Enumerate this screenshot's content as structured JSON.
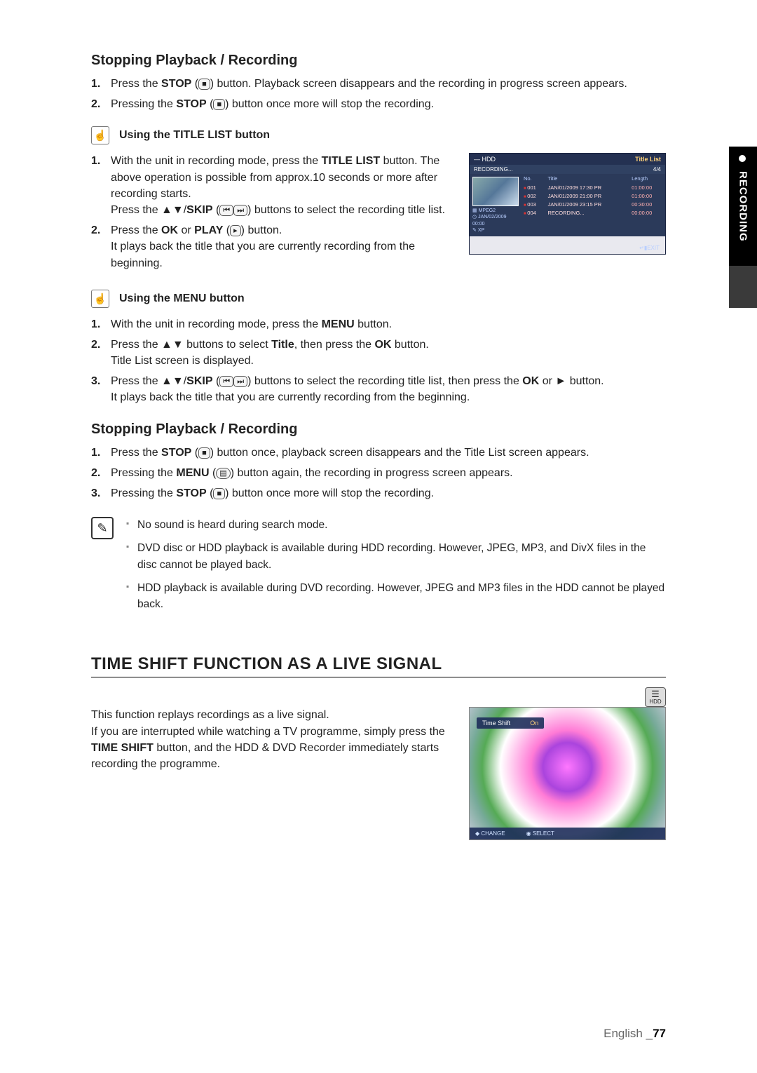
{
  "side_tab_label": "RECORDING",
  "section1": {
    "title": "Stopping Playback / Recording",
    "steps": [
      {
        "pre": "Press the ",
        "bold": "STOP",
        "icon": "■",
        "post": " button. Playback screen disappears and the recording in progress screen appears."
      },
      {
        "pre": "Pressing the ",
        "bold": "STOP",
        "icon": "■",
        "post": " button once more will stop the recording."
      }
    ]
  },
  "hint1": {
    "title": "Using the TITLE LIST button",
    "steps": [
      {
        "parts": [
          {
            "t": "With the unit in recording mode, press the "
          },
          {
            "b": "TITLE LIST"
          },
          {
            "t": " button. The above operation is possible from approx.10 seconds or more after recording starts."
          },
          {
            "br": true
          },
          {
            "t": "Press the ▲▼/"
          },
          {
            "b": "SKIP"
          },
          {
            "t": " ("
          },
          {
            "icon": "⏮"
          },
          {
            "icon": "⏭"
          },
          {
            "t": ") buttons to select the recording title list."
          }
        ]
      },
      {
        "parts": [
          {
            "t": "Press the "
          },
          {
            "b": "OK"
          },
          {
            "t": " or "
          },
          {
            "b": "PLAY"
          },
          {
            "t": " ("
          },
          {
            "icon": "▸"
          },
          {
            "t": ") button."
          },
          {
            "br": true
          },
          {
            "t": "It plays back the title that you are currently recording from the beginning."
          }
        ]
      }
    ]
  },
  "titlelist_ui": {
    "device": "HDD",
    "header_right": "Title List",
    "rec_label": "RECORDING...",
    "page": "4/4",
    "meta_codec": "MPEG2",
    "meta_date": "JAN/02/2009 00:00",
    "meta_mode": "XP",
    "cols": {
      "no": "No.",
      "title": "Title",
      "length": "Length"
    },
    "rows": [
      {
        "no": "001",
        "title": "JAN/01/2009 17:30 PR",
        "length": "01:00:00"
      },
      {
        "no": "002",
        "title": "JAN/01/2009 21:00 PR",
        "length": "01:00:00"
      },
      {
        "no": "003",
        "title": "JAN/01/2009 23:15 PR",
        "length": "00:30:00"
      },
      {
        "no": "004",
        "title": "RECORDING...",
        "length": "00:00:00"
      }
    ],
    "footer": "EXIT"
  },
  "hint2": {
    "title": "Using the MENU button",
    "steps": [
      {
        "parts": [
          {
            "t": "With the unit in recording mode, press the "
          },
          {
            "b": "MENU"
          },
          {
            "t": " button."
          }
        ]
      },
      {
        "parts": [
          {
            "t": "Press the ▲▼ buttons to select "
          },
          {
            "b": "Title"
          },
          {
            "t": ", then press the "
          },
          {
            "b": "OK"
          },
          {
            "t": " button."
          },
          {
            "br": true
          },
          {
            "t": "Title List screen is displayed."
          }
        ]
      },
      {
        "parts": [
          {
            "t": "Press the ▲▼/"
          },
          {
            "b": "SKIP"
          },
          {
            "t": " ("
          },
          {
            "icon": "⏮"
          },
          {
            "icon": "⏭"
          },
          {
            "t": ") buttons to select the recording title list, then press the "
          },
          {
            "b": "OK"
          },
          {
            "t": " or ► button."
          },
          {
            "br": true
          },
          {
            "t": "It plays back the title that you are currently recording from the beginning."
          }
        ]
      }
    ]
  },
  "section2": {
    "title": "Stopping Playback / Recording",
    "steps": [
      {
        "pre": "Press the ",
        "bold": "STOP",
        "icon": "■",
        "post": " button once, playback screen disappears and the Title List screen appears."
      },
      {
        "pre": "Pressing the ",
        "bold": "MENU",
        "icon": "▤",
        "post": " button again, the recording in progress screen appears."
      },
      {
        "pre": "Pressing the ",
        "bold": "STOP",
        "icon": "■",
        "post": " button once more will stop the recording."
      }
    ]
  },
  "notes": [
    "No sound is heard during search mode.",
    "DVD disc or HDD playback is available during HDD recording. However, JPEG, MP3, and DivX files in the disc cannot be played back.",
    "HDD playback is available during DVD recording. However, JPEG and MP3 files in the HDD cannot be played back."
  ],
  "main_title": "TIME SHIFT FUNCTION AS A LIVE SIGNAL",
  "hdd_badge": "HDD",
  "timeshift_text": {
    "line1": "This function replays recordings as a live signal.",
    "line2_pre": "If you are interrupted while watching a TV programme, simply press the ",
    "line2_bold": "TIME SHIFT",
    "line2_post": " button, and the HDD & DVD Recorder immediately starts recording the programme."
  },
  "ts_ui": {
    "label": "Time Shift",
    "value": "On",
    "footer_change": "CHANGE",
    "footer_select": "SELECT"
  },
  "footer": {
    "lang": "English",
    "sep": "_",
    "page": "77"
  }
}
